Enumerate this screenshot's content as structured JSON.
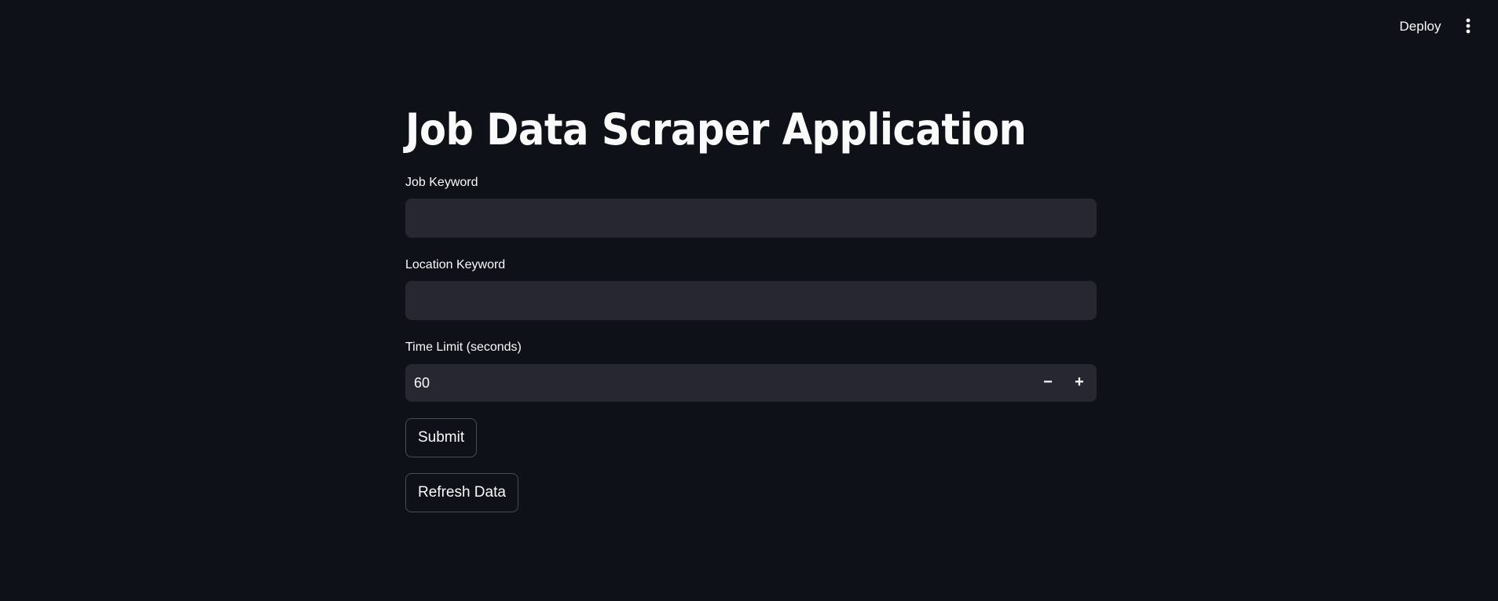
{
  "header": {
    "deploy_label": "Deploy",
    "menu_icon": "more-vertical-icon"
  },
  "main": {
    "title": "Job Data Scraper Application",
    "job_keyword": {
      "label": "Job Keyword",
      "value": ""
    },
    "location_keyword": {
      "label": "Location Keyword",
      "value": ""
    },
    "time_limit": {
      "label": "Time Limit (seconds)",
      "value": "60",
      "decrement": "−",
      "increment": "+"
    },
    "submit_label": "Submit",
    "refresh_label": "Refresh Data"
  },
  "colors": {
    "background": "#0e1117",
    "input_background": "#262730",
    "text": "#fafafa"
  }
}
